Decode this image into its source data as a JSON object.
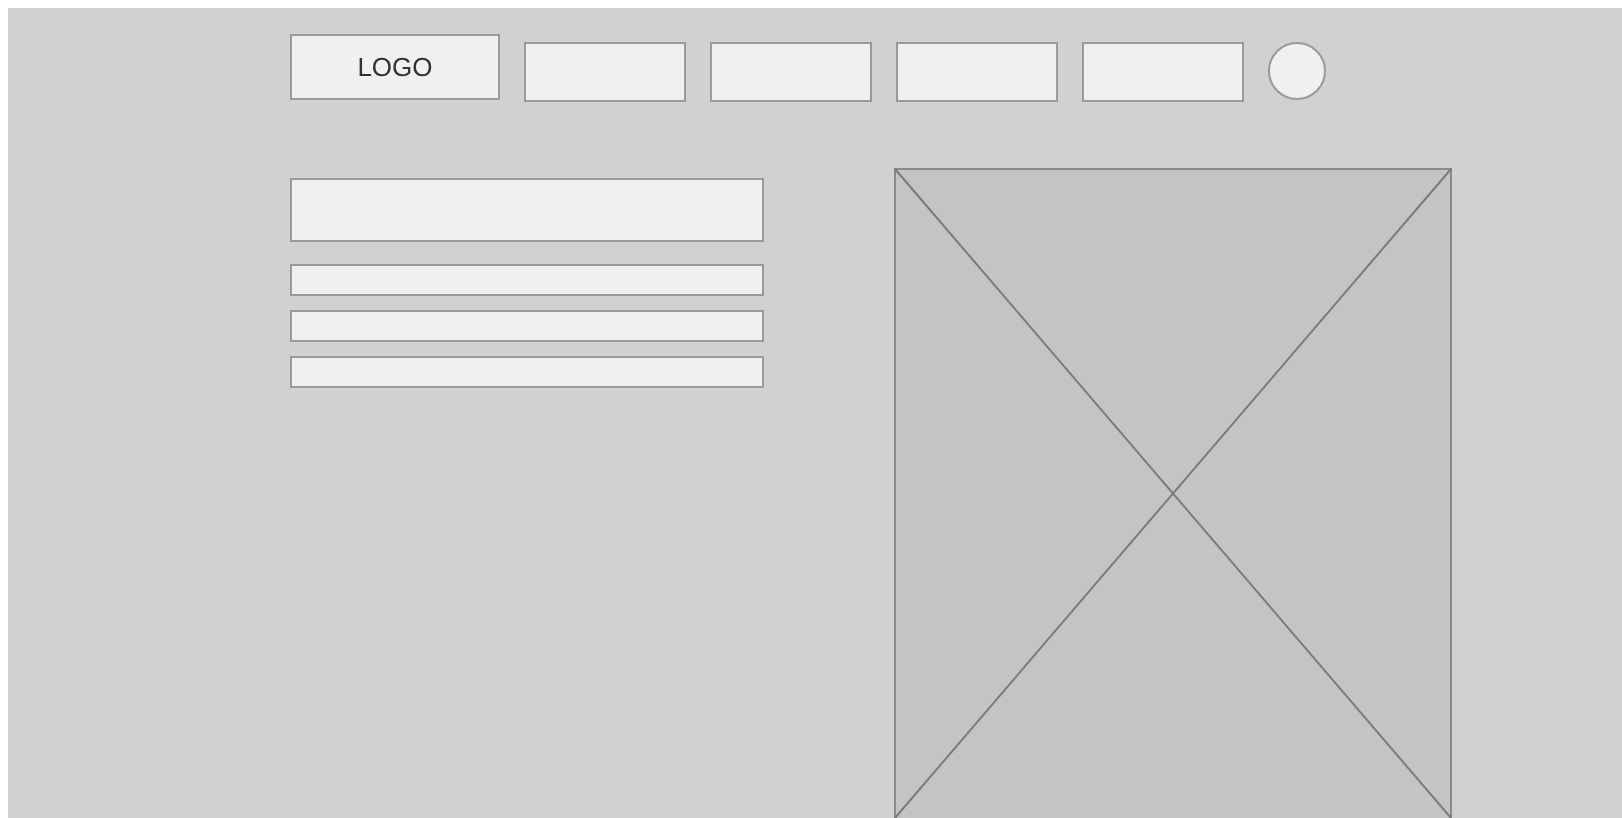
{
  "header": {
    "logo": "LOGO",
    "nav_items": [
      {
        "kind": "box"
      },
      {
        "kind": "box"
      },
      {
        "kind": "box"
      },
      {
        "kind": "box"
      }
    ],
    "avatar": {
      "kind": "circle"
    }
  },
  "content": {
    "blocks": [
      {
        "kind": "heading"
      },
      {
        "kind": "line"
      },
      {
        "kind": "line"
      },
      {
        "kind": "line"
      }
    ],
    "image": {
      "kind": "placeholder"
    }
  }
}
